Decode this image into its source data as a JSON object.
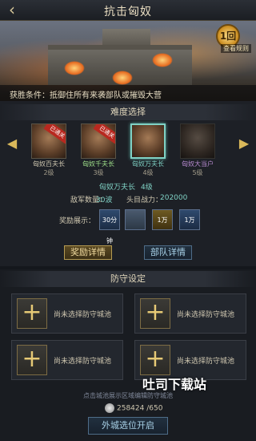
{
  "header": {
    "title": "抗击匈奴",
    "back_icon": "back-arrow-icon"
  },
  "banner": {
    "replay_label": "查看规则",
    "replay_badge": "1回",
    "win_condition": "获胜条件：抵御住所有来袭部队或摧毁大营"
  },
  "difficulty": {
    "title": "难度选择",
    "bosses": [
      {
        "name": "匈奴百夫长",
        "level": "2级",
        "badge": "已通关",
        "state": "cleared"
      },
      {
        "name": "匈奴千夫长",
        "level": "3级",
        "badge": "已通关",
        "state": "cleared"
      },
      {
        "name": "匈奴万夫长",
        "level": "4级",
        "badge": "",
        "state": "selected"
      },
      {
        "name": "匈奴大当户",
        "level": "5级",
        "badge": "",
        "state": "locked"
      }
    ],
    "selected_name": "匈奴万夫长",
    "selected_level": "4级",
    "enemy_count_label": "敌军数量：",
    "enemy_count_value": "30波",
    "leader_power_label": "头目战力：",
    "leader_power_value": "202000",
    "reward_label": "奖励展示：",
    "rewards": [
      "30分钟",
      "",
      "1万",
      "1万"
    ],
    "reward_detail_button": "奖励详情",
    "troop_detail_button": "部队详情"
  },
  "defense": {
    "title": "防守设定",
    "slots": [
      "尚未选择防守城池",
      "尚未选择防守城池",
      "尚未选择防守城池",
      "尚未选择防守城池"
    ],
    "hint": "点击城池展示区域编辑防守城池",
    "currency_value": "258424",
    "currency_max": "/650",
    "start_button": "外城选位开启"
  },
  "watermark": "吐司下载站",
  "colors": {
    "gold": "#d9b85a",
    "selected_border": "#7fd1c4",
    "badge_red": "#b8281f"
  }
}
